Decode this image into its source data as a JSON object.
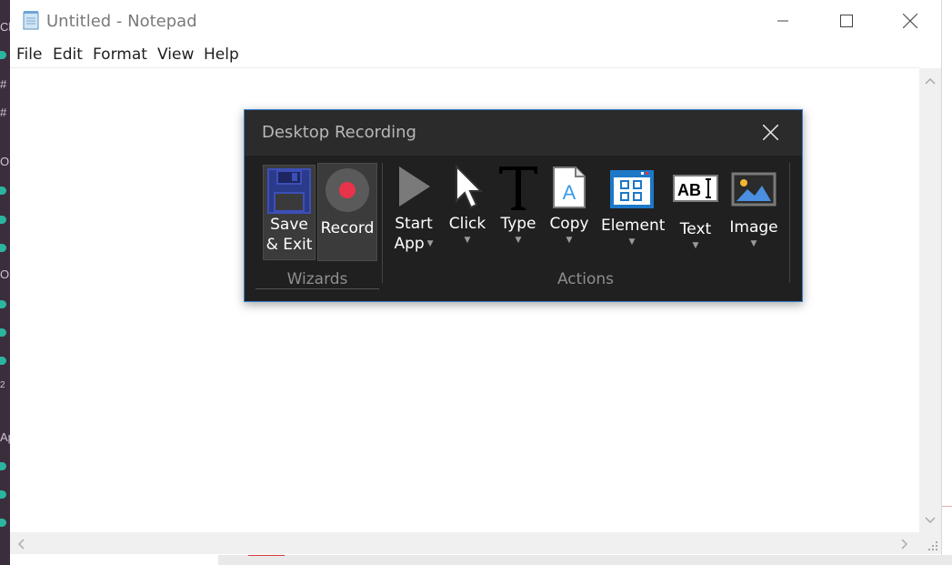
{
  "window": {
    "title": "Untitled - Notepad",
    "min_icon": "minimize-icon",
    "max_icon": "maximize-icon",
    "close_icon": "close-icon"
  },
  "menu": [
    "File",
    "Edit",
    "Format",
    "View",
    "Help"
  ],
  "editor": {
    "content": ""
  },
  "background_app": {
    "glyphs": [
      "Cl",
      "#",
      "#",
      "O",
      "O",
      "2",
      "Ap"
    ]
  },
  "recorder": {
    "title": "Desktop Recording",
    "close_icon": "close-icon",
    "wizards": {
      "label": "Wizards",
      "tools": [
        {
          "line1": "Save",
          "line2": "& Exit",
          "icon": "floppy-disk-icon"
        },
        {
          "line1": "Record",
          "line2": "",
          "icon": "record-icon"
        }
      ]
    },
    "actions": {
      "label": "Actions",
      "tools": [
        {
          "line1": "Start",
          "line2": "App",
          "icon": "play-icon"
        },
        {
          "line1": "Click",
          "icon": "cursor-icon"
        },
        {
          "line1": "Type",
          "icon": "type-t-icon"
        },
        {
          "line1": "Copy",
          "icon": "copy-document-icon"
        },
        {
          "line1": "Element",
          "icon": "element-window-icon"
        },
        {
          "line1": "Text",
          "icon": "text-ocr-icon",
          "glyph": "AB"
        },
        {
          "line1": "Image",
          "icon": "image-icon"
        }
      ]
    },
    "colors": {
      "accent_border": "#3a7fd0",
      "record_dot": "#e8334a",
      "element_blue": "#1d78c8",
      "save_blue": "#2f3f9e"
    }
  }
}
